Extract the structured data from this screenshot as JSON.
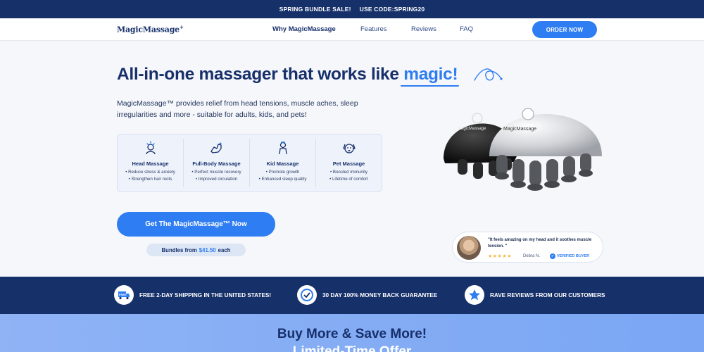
{
  "announcement": {
    "sale": "SPRING BUNDLE SALE!",
    "code": "USE CODE:SPRING20"
  },
  "header": {
    "logo": "MagicMassage",
    "logo_mark": "+",
    "nav": [
      {
        "label": "Why MagicMassage"
      },
      {
        "label": "Features"
      },
      {
        "label": "Reviews"
      },
      {
        "label": "FAQ"
      }
    ],
    "order_button": "ORDER NOW"
  },
  "hero": {
    "title_prefix": "All-in-one massager that works like",
    "title_highlight": "magic!",
    "description": "MagicMassage™ provides relief from head tensions, muscle aches, sleep irregularities and more - suitable for adults, kids, and pets!",
    "features": [
      {
        "title": "Head Massage",
        "lines": [
          "• Reduce stress & anxiety",
          "• Strengthen hair roots"
        ]
      },
      {
        "title": "Full-Body Massage",
        "lines": [
          "• Perfect muscle recovery",
          "• Improved circulation"
        ]
      },
      {
        "title": "Kid Massage",
        "lines": [
          "• Promote growth",
          "• Enhanced sleep quality"
        ]
      },
      {
        "title": "Pet Massage",
        "lines": [
          "• Boosted immunity",
          "• Lifetime of comfort"
        ]
      }
    ],
    "cta": "Get The MagicMassage™ Now",
    "bundle_prefix": "Bundles from",
    "bundle_price": "$41.50",
    "bundle_suffix": "each"
  },
  "product": {
    "label": "MagicMassage"
  },
  "review": {
    "quote": "\"It feels amazing on my head and it soothes muscle tension. \"",
    "stars": "★★★★★",
    "reviewer": "Debra N.",
    "verified": "VERIFIED BUYER"
  },
  "trust": [
    {
      "label": "FREE 2-DAY SHIPPING IN THE UNITED STATES!",
      "icon": "free-shipping-icon",
      "badge": "FREE"
    },
    {
      "label": "30 DAY 100% MONEY BACK GUARANTEE",
      "icon": "guarantee-badge-icon"
    },
    {
      "label": "RAVE REVIEWS FROM OUR CUSTOMERS",
      "icon": "star-icon"
    }
  ],
  "promo": {
    "title": "Buy More & Save More!",
    "subtitle": "Limited-Time Offer"
  },
  "colors": {
    "navy": "#16306a",
    "accent": "#2f7df2",
    "background": "#f6f7fa"
  }
}
